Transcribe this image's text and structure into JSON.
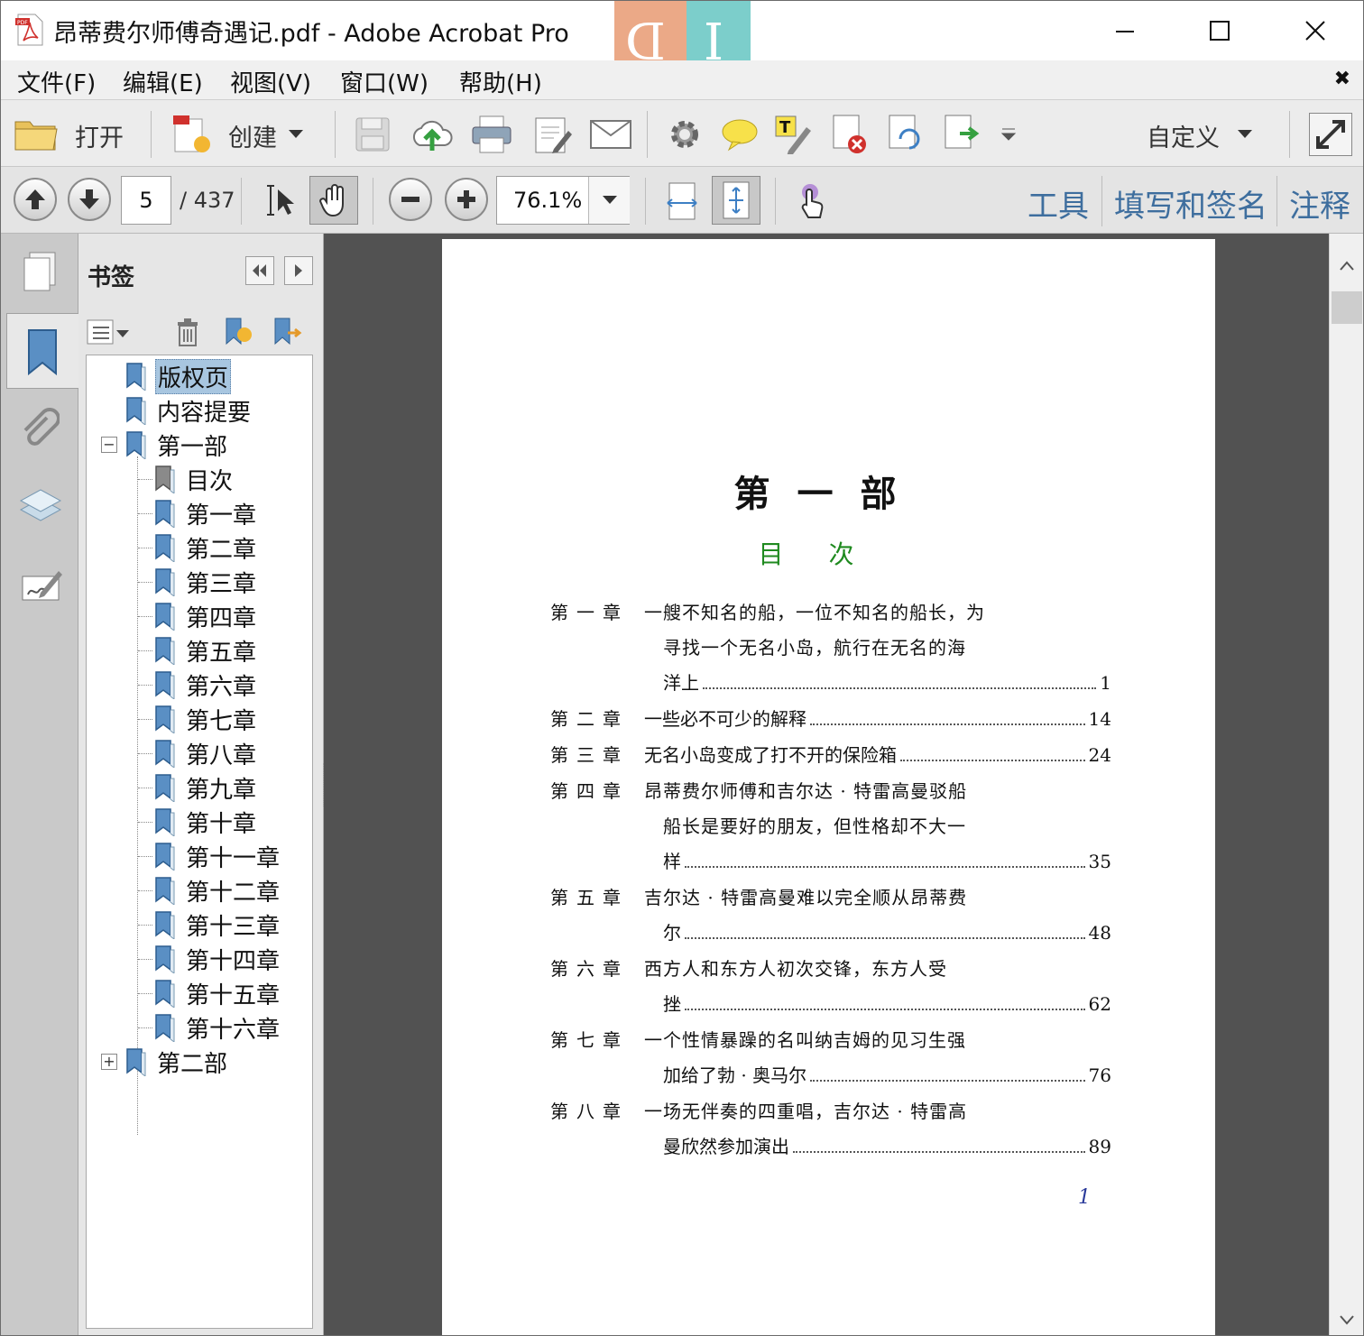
{
  "window": {
    "title": "昂蒂费尔师傅奇遇记.pdf - Adobe Acrobat Pro",
    "logo_letters": [
      "D",
      "I"
    ],
    "colors": {
      "logo_left": "#e9a07a",
      "logo_right": "#6ec9c5"
    }
  },
  "menu": {
    "items": [
      "文件(F)",
      "编辑(E)",
      "视图(V)",
      "窗口(W)",
      "帮助(H)"
    ],
    "close": "✖"
  },
  "toolbar": {
    "open_label": "打开",
    "create_label": "创建",
    "customize_label": "自定义"
  },
  "nav": {
    "page_current": "5",
    "page_total": "/ 437",
    "zoom": "76.1%",
    "links": [
      "工具",
      "填写和签名",
      "注释"
    ],
    "link_color": "#3e6e9e"
  },
  "bookmarks": {
    "title": "书签",
    "items": [
      {
        "label": "版权页",
        "selected": true
      },
      {
        "label": "内容提要"
      },
      {
        "label": "第一部",
        "expander": "−"
      },
      {
        "label": "目次"
      },
      {
        "label": "第一章"
      },
      {
        "label": "第二章"
      },
      {
        "label": "第三章"
      },
      {
        "label": "第四章"
      },
      {
        "label": "第五章"
      },
      {
        "label": "第六章"
      },
      {
        "label": "第七章"
      },
      {
        "label": "第八章"
      },
      {
        "label": "第九章"
      },
      {
        "label": "第十章"
      },
      {
        "label": "第十一章"
      },
      {
        "label": "第十二章"
      },
      {
        "label": "第十三章"
      },
      {
        "label": "第十四章"
      },
      {
        "label": "第十五章"
      },
      {
        "label": "第十六章"
      },
      {
        "label": "第二部",
        "expander": "+"
      }
    ]
  },
  "document": {
    "part_title": "第一部",
    "toc_title": "目次",
    "toc_title_color": "#1f8a1f",
    "entries": [
      {
        "num": "第一章",
        "lines": [
          "一艘不知名的船，一位不知名的船长，为",
          "寻找一个无名小岛，航行在无名的海",
          "洋上"
        ],
        "page": "1"
      },
      {
        "num": "第二章",
        "lines": [
          "一些必不可少的解释"
        ],
        "page": "14"
      },
      {
        "num": "第三章",
        "lines": [
          "无名小岛变成了打不开的保险箱"
        ],
        "page": "24"
      },
      {
        "num": "第四章",
        "lines": [
          "昂蒂费尔师傅和吉尔达 · 特雷高曼驳船",
          "船长是要好的朋友，但性格却不大一",
          "样"
        ],
        "page": "35"
      },
      {
        "num": "第五章",
        "lines": [
          "吉尔达 · 特雷高曼难以完全顺从昂蒂费",
          "尔"
        ],
        "page": "48"
      },
      {
        "num": "第六章",
        "lines": [
          "西方人和东方人初次交锋，东方人受",
          "挫"
        ],
        "page": "62"
      },
      {
        "num": "第七章",
        "lines": [
          "一个性情暴躁的名叫纳吉姆的见习生强",
          "加给了勃 · 奥马尔"
        ],
        "page": "76"
      },
      {
        "num": "第八章",
        "lines": [
          "一场无伴奏的四重唱，吉尔达 · 特雷高",
          "曼欣然参加演出"
        ],
        "page": "89"
      }
    ],
    "page_number": "1"
  }
}
